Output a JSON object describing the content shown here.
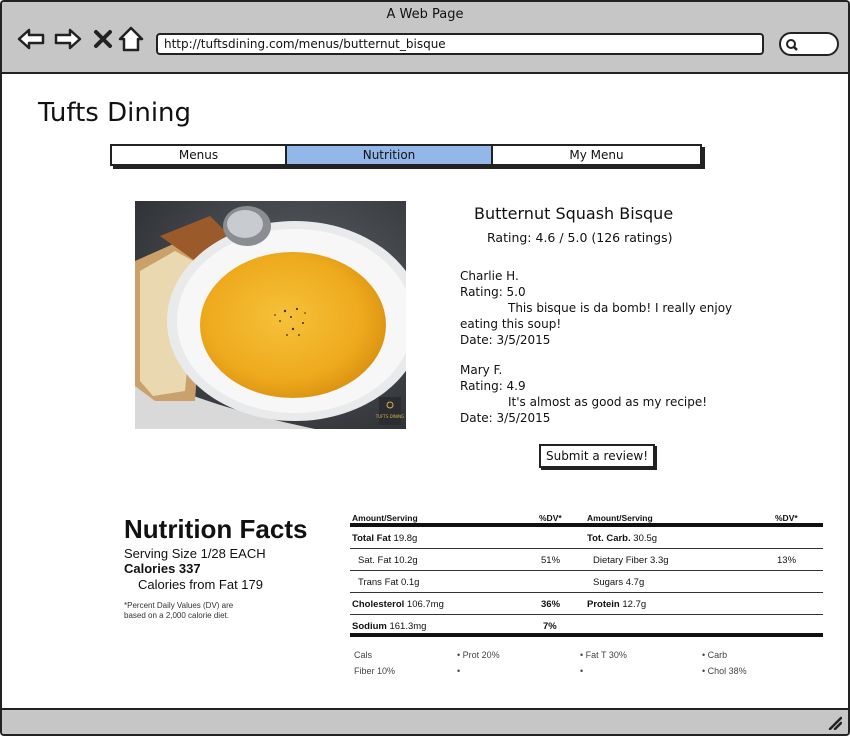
{
  "browser": {
    "window_title": "A Web Page",
    "url": "http://tuftsdining.com/menus/butternut_bisque"
  },
  "site": {
    "title": "Tufts Dining"
  },
  "tabs": [
    {
      "label": "Menus",
      "active": false
    },
    {
      "label": "Nutrition",
      "active": true
    },
    {
      "label": "My Menu",
      "active": false
    }
  ],
  "dish": {
    "name": "Butternut Squash Bisque",
    "rating": "Rating: 4.6 / 5.0 (126 ratings)",
    "image_watermark": "TUFTS DINING"
  },
  "reviews": [
    {
      "author": "Charlie H.",
      "rating": "Rating: 5.0",
      "text_line1": "This bisque is da bomb! I really enjoy",
      "text_line2": "eating this soup!",
      "date": "Date: 3/5/2015"
    },
    {
      "author": "Mary F.",
      "rating": "Rating: 4.9",
      "text_line1": "It's almost as good as my recipe!",
      "date": "Date: 3/5/2015"
    }
  ],
  "submit_label": "Submit a review!",
  "nutrition": {
    "title": "Nutrition Facts",
    "serving": "Serving Size 1/28 EACH",
    "calories": "Calories 337",
    "calories_fat": "Calories from Fat 179",
    "footnote": "*Percent Daily Values (DV) are based on a 2,000 calorie diet.",
    "headers": {
      "amount_left": "Amount/Serving",
      "dv_left": "%DV*",
      "amount_right": "Amount/Serving",
      "dv_right": "%DV*"
    },
    "rows": [
      {
        "l_label": "Total Fat",
        "l_value": "19.8g",
        "l_dv": "",
        "r_label": "Tot. Carb.",
        "r_value": "30.5g",
        "r_dv": ""
      },
      {
        "l_label": "Sat. Fat",
        "l_value": "10.2g",
        "l_dv": "51%",
        "r_label": "Dietary Fiber",
        "r_value": "3.3g",
        "r_dv": "13%"
      },
      {
        "l_label": "Trans Fat",
        "l_value": "0.1g",
        "l_dv": "",
        "r_label": "Sugars",
        "r_value": "4.7g",
        "r_dv": ""
      },
      {
        "l_label": "Cholesterol",
        "l_value": "106.7mg",
        "l_dv": "36%",
        "r_label": "Protein",
        "r_value": "12.7g",
        "r_dv": ""
      },
      {
        "l_label": "Sodium",
        "l_value": "161.3mg",
        "l_dv": "7%",
        "r_label": "",
        "r_value": "",
        "r_dv": ""
      }
    ],
    "legend": [
      "Cals",
      "• Prot   20%",
      "• Fat T   30%",
      "• Carb",
      "Fiber   10%",
      "•",
      "•",
      "• Chol   38%"
    ]
  }
}
